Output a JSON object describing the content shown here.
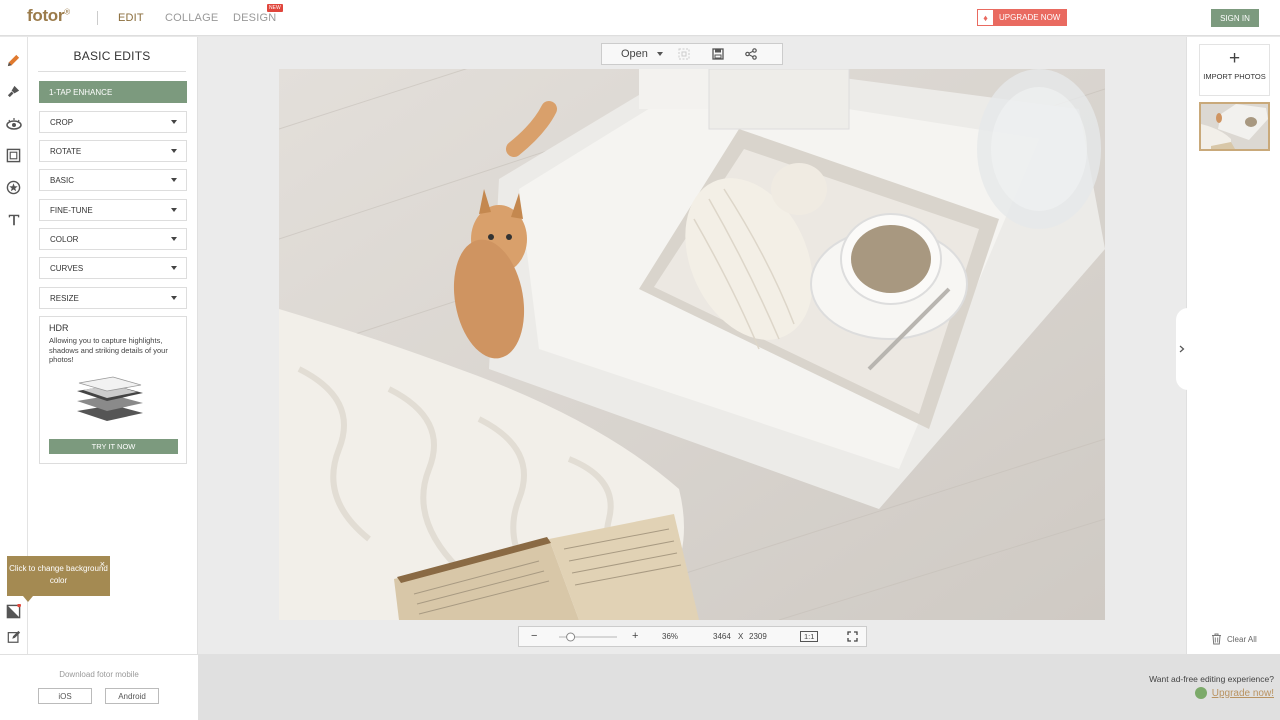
{
  "header": {
    "logo": "fotor",
    "logo_mark": "®",
    "nav": {
      "edit": "EDIT",
      "collage": "COLLAGE",
      "design": "DESIGN",
      "new_badge": "NEW"
    },
    "upgrade_label": "UPGRADE NOW",
    "signin_label": "SIGN IN"
  },
  "rail": {
    "icons": [
      "pencil-icon",
      "paint-brush-icon",
      "eye-icon",
      "frame-icon",
      "sticker-icon",
      "text-icon",
      "background-icon",
      "edit-note-icon"
    ]
  },
  "left_panel": {
    "title": "BASIC EDITS",
    "enhance_label": "1-TAP ENHANCE",
    "items": [
      "CROP",
      "ROTATE",
      "BASIC",
      "FINE-TUNE",
      "COLOR",
      "CURVES",
      "RESIZE"
    ],
    "hdr": {
      "title": "HDR",
      "description": "Allowing you to capture highlights, shadows and striking details of your photos!",
      "cta": "TRY IT NOW"
    },
    "tooltip": {
      "text": "Click to change background color",
      "close": "×"
    },
    "mobile": {
      "text": "Download fotor mobile",
      "ios": "iOS",
      "android": "Android"
    }
  },
  "toolbar": {
    "open_label": "Open"
  },
  "zoombar": {
    "minus": "−",
    "plus": "+",
    "zoom": "36%",
    "width": "3464",
    "times": "X",
    "height": "2309",
    "ratio_label": "1:1"
  },
  "zoom_level": 0.36,
  "right_panel": {
    "import_plus": "+",
    "import_label": "IMPORT PHOTOS",
    "clear_label": "Clear All"
  },
  "promo": {
    "text": "Want ad-free editing experience?",
    "link": "Upgrade now!"
  },
  "colors": {
    "accent": "#7c9a7e",
    "brand": "#9b7b4a",
    "upgrade": "#e96a60",
    "tooltip": "#a48a52"
  }
}
